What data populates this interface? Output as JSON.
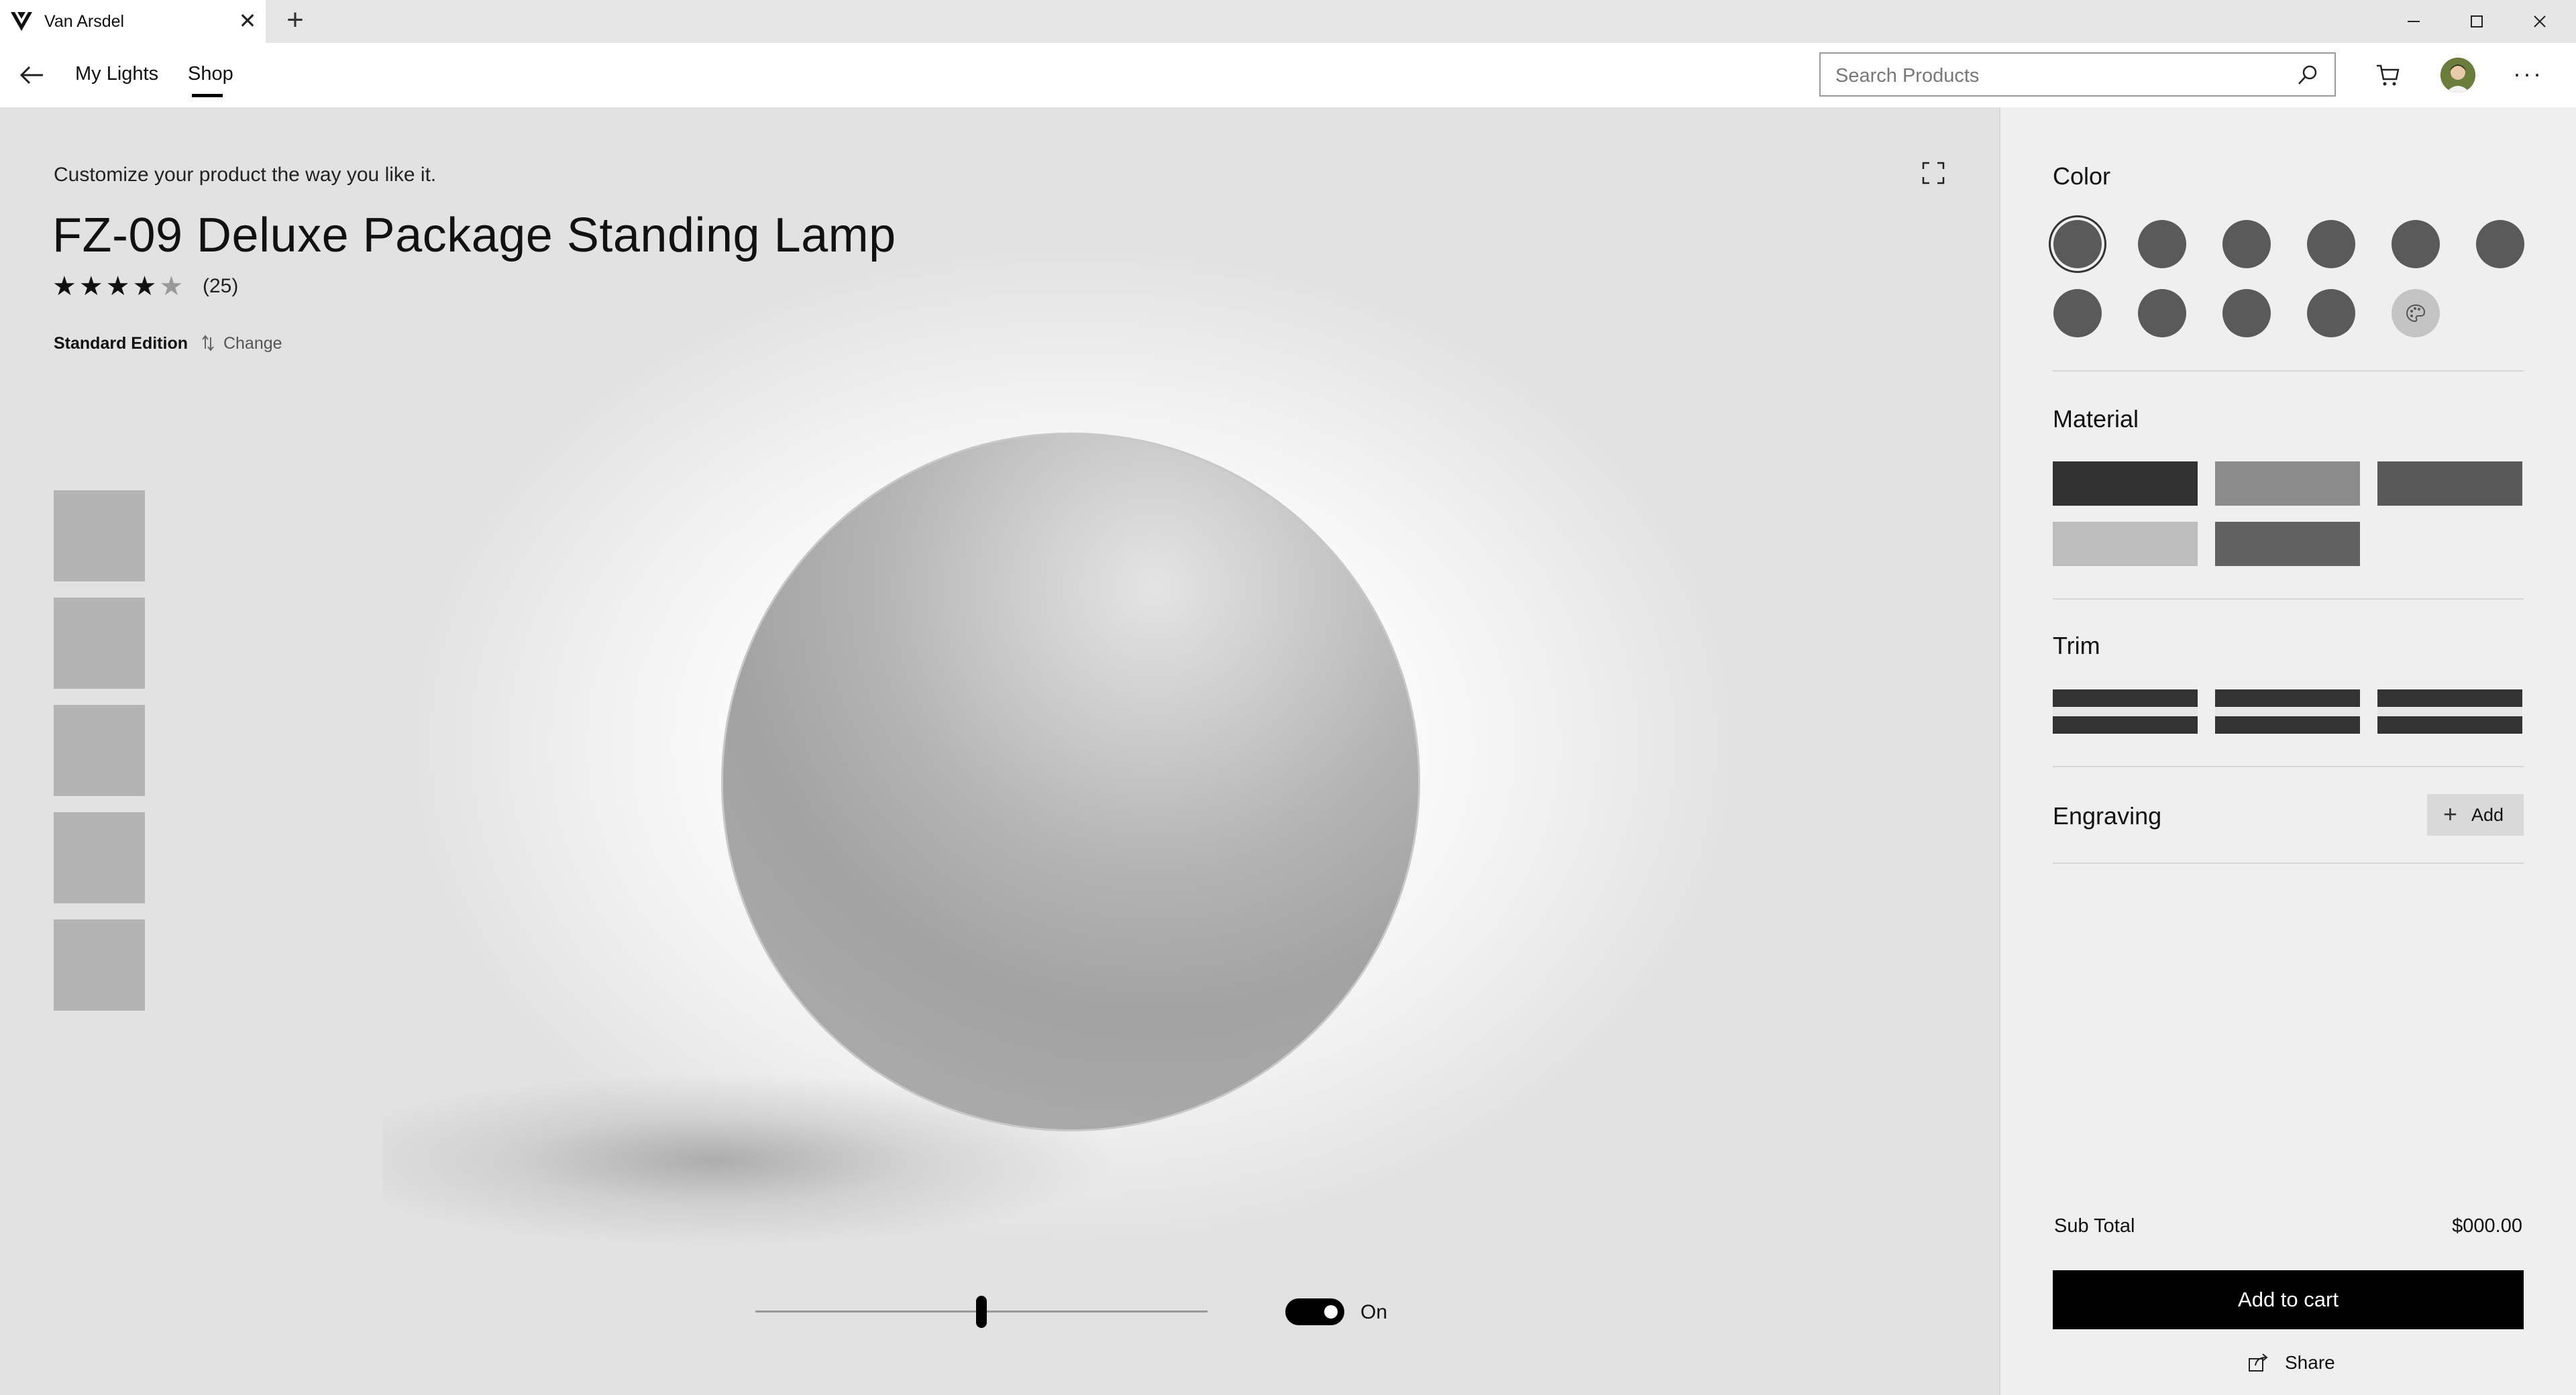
{
  "window": {
    "tab_title": "Van Arsdel",
    "tab_close": "✕",
    "new_tab": "+"
  },
  "appbar": {
    "nav": [
      "My Lights",
      "Shop"
    ],
    "active_nav": "Shop",
    "search_placeholder": "Search Products",
    "more": "···"
  },
  "product": {
    "subtitle": "Customize your product the way you like it.",
    "title": "FZ-09 Deluxe Package Standing Lamp",
    "rating": 4,
    "rating_max": 5,
    "stars_filled": "★★★★",
    "stars_empty": "★",
    "review_count": "(25)",
    "edition": "Standard Edition",
    "change_label": "Change",
    "thumbnail_count": 5,
    "brightness": 0.5,
    "power_toggle_label": "On",
    "power_on": true
  },
  "panel": {
    "color": {
      "title": "Color",
      "swatch_count": 10,
      "selected_index": 0,
      "custom_icon": "palette-icon"
    },
    "material": {
      "title": "Material",
      "swatches": [
        "#323232",
        "#8c8c8c",
        "#595959",
        "#bdbdbd",
        "#616161"
      ]
    },
    "trim": {
      "title": "Trim",
      "count": 3
    },
    "engraving": {
      "title": "Engraving",
      "add_label": "Add"
    },
    "subtotal_label": "Sub Total",
    "subtotal_value": "$000.00",
    "add_to_cart": "Add to cart",
    "share": "Share"
  },
  "colors": {
    "accent": "#000000",
    "content_bg": "#e2e2e2",
    "panel_bg": "#efefef"
  }
}
